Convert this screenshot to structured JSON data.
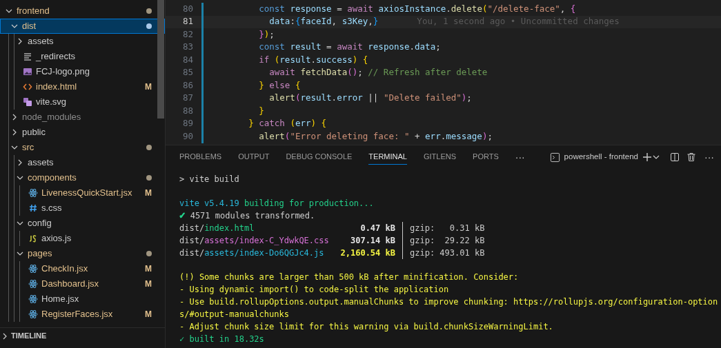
{
  "explorer": {
    "tree": [
      {
        "name": "frontend",
        "kind": "folder",
        "expanded": true,
        "modified": true,
        "ignored": false,
        "dot": true,
        "selected": false,
        "children": [
          {
            "name": "dist",
            "kind": "folder",
            "expanded": true,
            "modified": true,
            "ignored": false,
            "dot": true,
            "selected": true,
            "children": [
              {
                "name": "assets",
                "kind": "folder",
                "expanded": false,
                "modified": false,
                "ignored": false,
                "dot": false,
                "selected": false
              },
              {
                "name": "_redirects",
                "kind": "text",
                "modified": false,
                "ignored": false,
                "selected": false
              },
              {
                "name": "FCJ-logo.png",
                "kind": "image",
                "modified": false,
                "ignored": false,
                "selected": false
              },
              {
                "name": "index.html",
                "kind": "html",
                "modified": true,
                "ignored": false,
                "badge": "M",
                "selected": false
              },
              {
                "name": "vite.svg",
                "kind": "svg",
                "modified": false,
                "ignored": false,
                "selected": false
              }
            ]
          },
          {
            "name": "node_modules",
            "kind": "folder",
            "expanded": false,
            "modified": false,
            "ignored": true,
            "dot": false,
            "selected": false
          },
          {
            "name": "public",
            "kind": "folder",
            "expanded": false,
            "modified": false,
            "ignored": false,
            "dot": false,
            "selected": false
          },
          {
            "name": "src",
            "kind": "folder",
            "expanded": true,
            "modified": true,
            "ignored": false,
            "dot": true,
            "selected": false,
            "children": [
              {
                "name": "assets",
                "kind": "folder",
                "expanded": false,
                "modified": false,
                "ignored": false,
                "dot": false,
                "selected": false
              },
              {
                "name": "components",
                "kind": "folder",
                "expanded": true,
                "modified": true,
                "ignored": false,
                "dot": true,
                "selected": false,
                "children": [
                  {
                    "name": "LivenessQuickStart.jsx",
                    "kind": "react",
                    "modified": true,
                    "ignored": false,
                    "badge": "M",
                    "selected": false
                  },
                  {
                    "name": "s.css",
                    "kind": "css",
                    "modified": false,
                    "ignored": false,
                    "selected": false
                  }
                ]
              },
              {
                "name": "config",
                "kind": "folder",
                "expanded": true,
                "modified": false,
                "ignored": false,
                "dot": false,
                "selected": false,
                "children": [
                  {
                    "name": "axios.js",
                    "kind": "js",
                    "modified": false,
                    "ignored": false,
                    "selected": false
                  }
                ]
              },
              {
                "name": "pages",
                "kind": "folder",
                "expanded": true,
                "modified": true,
                "ignored": false,
                "dot": true,
                "selected": false,
                "children": [
                  {
                    "name": "CheckIn.jsx",
                    "kind": "react",
                    "modified": true,
                    "ignored": false,
                    "badge": "M",
                    "selected": false
                  },
                  {
                    "name": "Dashboard.jsx",
                    "kind": "react",
                    "modified": true,
                    "ignored": false,
                    "badge": "M",
                    "selected": false
                  },
                  {
                    "name": "Home.jsx",
                    "kind": "react",
                    "modified": false,
                    "ignored": false,
                    "selected": false
                  },
                  {
                    "name": "RegisterFaces.jsx",
                    "kind": "react",
                    "modified": true,
                    "ignored": false,
                    "badge": "M",
                    "selected": false
                  }
                ]
              }
            ]
          }
        ]
      }
    ],
    "timeline": {
      "title": "TIMELINE",
      "expanded": false
    }
  },
  "editor": {
    "lines": [
      {
        "number": "80",
        "current": false,
        "code": "        const response = await axiosInstance.delete(\"/delete-face\", {"
      },
      {
        "number": "81",
        "current": true,
        "code": "          data:{faceId, s3Key,}",
        "blame": "You, 1 second ago • Uncommitted changes"
      },
      {
        "number": "82",
        "current": false,
        "code": "        });"
      },
      {
        "number": "83",
        "current": false,
        "code": "        const result = await response.data;"
      },
      {
        "number": "84",
        "current": false,
        "code": "        if (result.success) {"
      },
      {
        "number": "85",
        "current": false,
        "code": "          await fetchData(); // Refresh after delete"
      },
      {
        "number": "86",
        "current": false,
        "code": "        } else {"
      },
      {
        "number": "87",
        "current": false,
        "code": "          alert(result.error || \"Delete failed\");"
      },
      {
        "number": "88",
        "current": false,
        "code": "        }"
      },
      {
        "number": "89",
        "current": false,
        "code": "      } catch (err) {"
      },
      {
        "number": "90",
        "current": false,
        "code": "        alert(\"Error deleting face: \" + err.message);"
      }
    ]
  },
  "panel": {
    "tabs": [
      {
        "label": "PROBLEMS",
        "selected": false
      },
      {
        "label": "OUTPUT",
        "selected": false
      },
      {
        "label": "DEBUG CONSOLE",
        "selected": false
      },
      {
        "label": "TERMINAL",
        "selected": true
      },
      {
        "label": "GITLENS",
        "selected": false
      },
      {
        "label": "PORTS",
        "selected": false
      }
    ],
    "more": "···",
    "terminal_name": "powershell - frontend",
    "actions_more": "···",
    "output": [
      {
        "kind": "text",
        "segments": [
          {
            "color": "#cccccc",
            "t": "> vite build"
          }
        ]
      },
      {
        "kind": "blank"
      },
      {
        "kind": "text",
        "segments": [
          {
            "color": "#29b8db",
            "t": "vite v5.4.19 "
          },
          {
            "color": "#23d18b",
            "t": "building for production..."
          }
        ]
      },
      {
        "kind": "text",
        "segments": [
          {
            "color": "#23d18b",
            "t": "✓"
          },
          {
            "color": "#cccccc",
            "t": " 4571 modules transformed."
          }
        ]
      },
      {
        "kind": "file_row",
        "dir": "dist/",
        "path": {
          "t": "index.html",
          "color": "#23d18b"
        },
        "size": {
          "t": "0.47 kB",
          "color": "#e5e5e5"
        },
        "gzip": "gzip:   0.31 kB"
      },
      {
        "kind": "file_row",
        "dir": "dist/",
        "path": {
          "t": "assets/index-C_YdwkQE.css",
          "color": "#d670d6"
        },
        "size": {
          "t": "307.14 kB",
          "color": "#e5e5e5"
        },
        "gzip": "gzip:  29.22 kB"
      },
      {
        "kind": "file_row",
        "dir": "dist/",
        "path": {
          "t": "assets/index-Do6QGJc4.js",
          "color": "#29b8db"
        },
        "size": {
          "t": "2,160.54 kB",
          "color": "#f5f543"
        },
        "gzip": "gzip: 493.01 kB"
      },
      {
        "kind": "blank"
      },
      {
        "kind": "text",
        "segments": [
          {
            "color": "#f5f543",
            "t": "(!) Some chunks are larger than 500 kB after minification. Consider:"
          }
        ]
      },
      {
        "kind": "text",
        "segments": [
          {
            "color": "#f5f543",
            "t": "- Using dynamic import() to code-split the application"
          }
        ]
      },
      {
        "kind": "text",
        "segments": [
          {
            "color": "#f5f543",
            "t": "- Use build.rollupOptions.output.manualChunks to improve chunking: https://rollupjs.org/configuration-option"
          }
        ]
      },
      {
        "kind": "text",
        "segments": [
          {
            "color": "#f5f543",
            "t": "s/#output-manualchunks"
          }
        ]
      },
      {
        "kind": "text",
        "segments": [
          {
            "color": "#f5f543",
            "t": "- Adjust chunk size limit for this warning via build.chunkSizeWarningLimit."
          }
        ]
      },
      {
        "kind": "text",
        "segments": [
          {
            "color": "#23d18b",
            "t": "✓ built in 18.32s"
          }
        ]
      }
    ]
  }
}
